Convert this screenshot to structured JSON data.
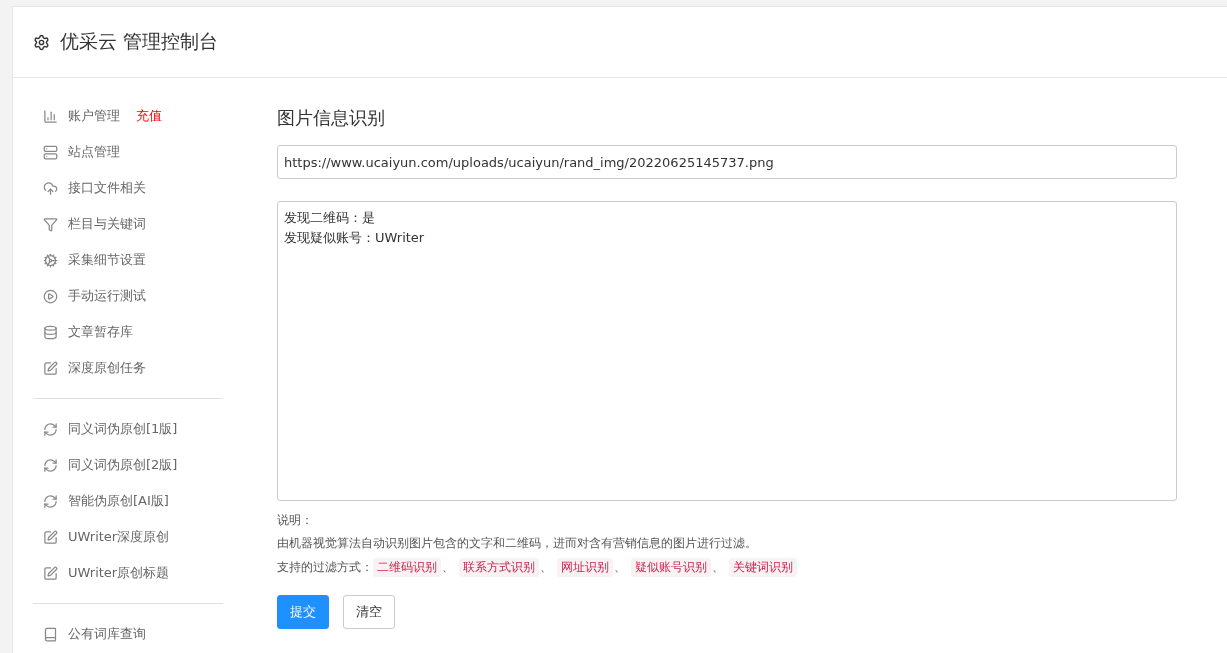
{
  "header": {
    "title": "优采云 管理控制台"
  },
  "sidebar": {
    "groups": [
      [
        {
          "label": "账户管理",
          "badge": "充值"
        },
        {
          "label": "站点管理"
        },
        {
          "label": "接口文件相关"
        },
        {
          "label": "栏目与关键词"
        },
        {
          "label": "采集细节设置"
        },
        {
          "label": "手动运行测试"
        },
        {
          "label": "文章暂存库"
        },
        {
          "label": "深度原创任务"
        }
      ],
      [
        {
          "label": "同义词伪原创[1版]"
        },
        {
          "label": "同义词伪原创[2版]"
        },
        {
          "label": "智能伪原创[AI版]"
        },
        {
          "label": "UWriter深度原创"
        },
        {
          "label": "UWriter原创标题"
        }
      ],
      [
        {
          "label": "公有词库查询"
        }
      ]
    ]
  },
  "main": {
    "title": "图片信息识别",
    "url_value": "https://www.ucaiyun.com/uploads/ucaiyun/rand_img/20220625145737.png",
    "result_lines": [
      "发现二维码：是",
      "发现疑似账号：UWriter"
    ],
    "notes_title": "说明：",
    "notes_text": "由机器视觉算法自动识别图片包含的文字和二维码，进而对含有营销信息的图片进行过滤。",
    "methods_label": "支持的过滤方式：",
    "separator": "、",
    "methods": [
      "二维码识别",
      "联系方式识别",
      "网址识别",
      "疑似账号识别",
      "关键词识别"
    ],
    "buttons": [
      {
        "label": "提交",
        "kind": "primary"
      },
      {
        "label": "清空",
        "kind": "default"
      }
    ]
  }
}
